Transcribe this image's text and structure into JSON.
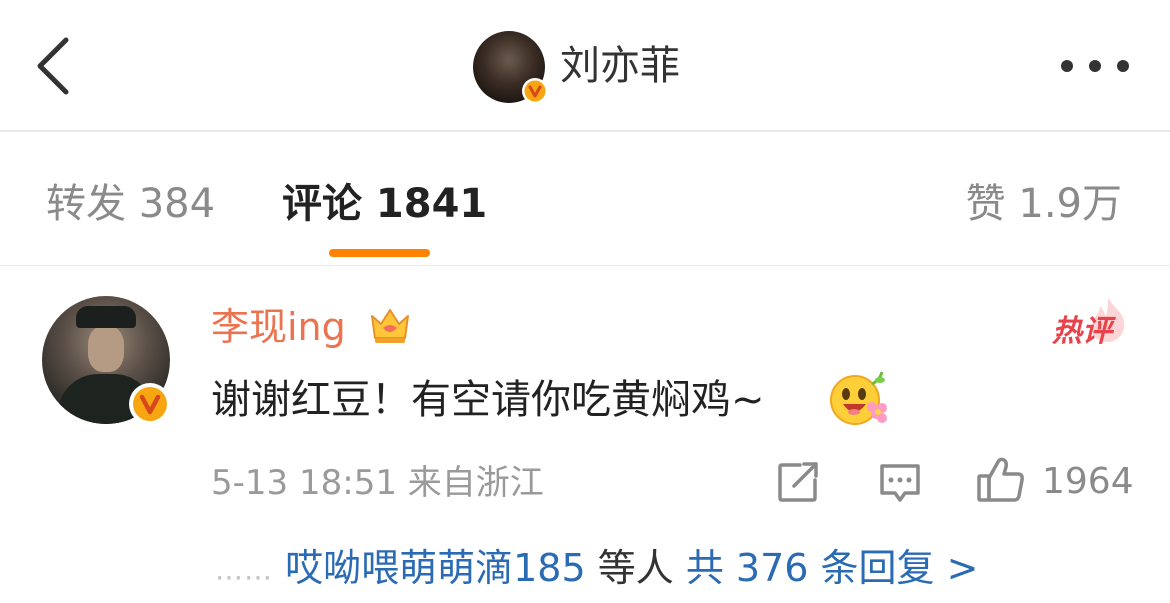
{
  "header": {
    "title": "刘亦菲",
    "back_icon": "chevron-left-icon",
    "more_icon": "more-dots-icon"
  },
  "tabs": {
    "repost": "转发 384",
    "comment": "评论 1841",
    "like": "赞 1.9万",
    "active_color": "#ff8200"
  },
  "comment": {
    "username": "李现ing",
    "username_color": "#eb7350",
    "hot_label": "热评",
    "text": "谢谢红豆！有空请你吃黄焖鸡~",
    "time": "5-13 18:51",
    "location": "来自浙江",
    "like_count": "1964",
    "replies": {
      "dots": "……",
      "names": "哎呦喂萌萌滴185",
      "suffix": "等人",
      "total": "共 376 条回复 >"
    }
  }
}
